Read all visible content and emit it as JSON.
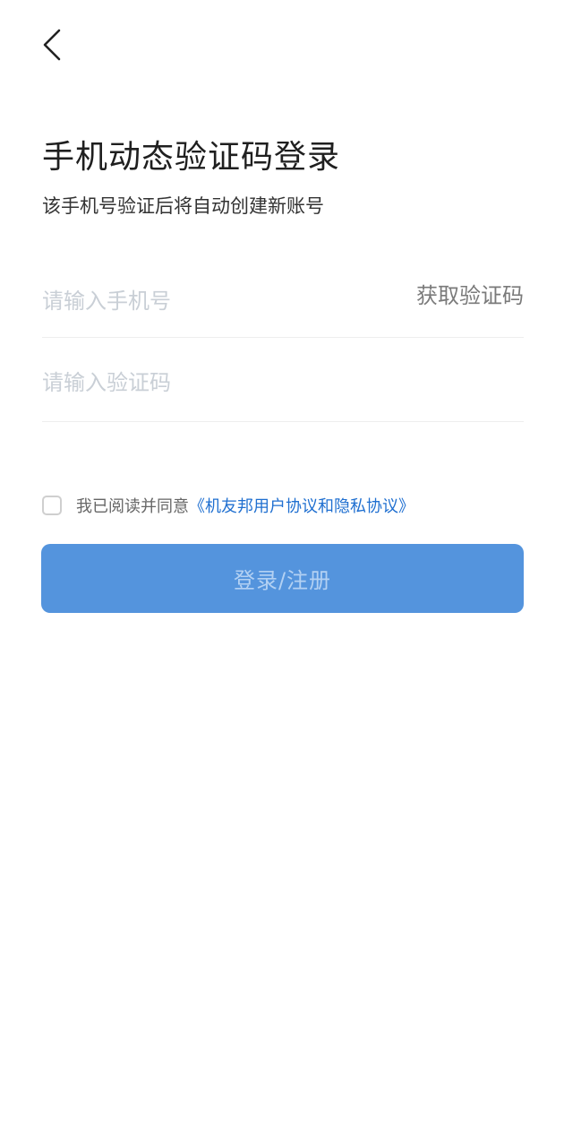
{
  "header": {
    "back_icon": "chevron-left-icon"
  },
  "title": "手机动态验证码登录",
  "subtitle": "该手机号验证后将自动创建新账号",
  "phone_field": {
    "placeholder": "请输入手机号",
    "value": "",
    "get_code_label": "获取验证码"
  },
  "code_field": {
    "placeholder": "请输入验证码",
    "value": ""
  },
  "agreement": {
    "checked": false,
    "text": "我已阅读并同意",
    "link": "《机友邦用户协议和隐私协议》"
  },
  "login_button": {
    "label": "登录/注册"
  },
  "colors": {
    "primary_button": "#5494dd",
    "button_text": "#b3d1f3",
    "link": "#1f6fd0",
    "placeholder": "#c9cfd6"
  }
}
